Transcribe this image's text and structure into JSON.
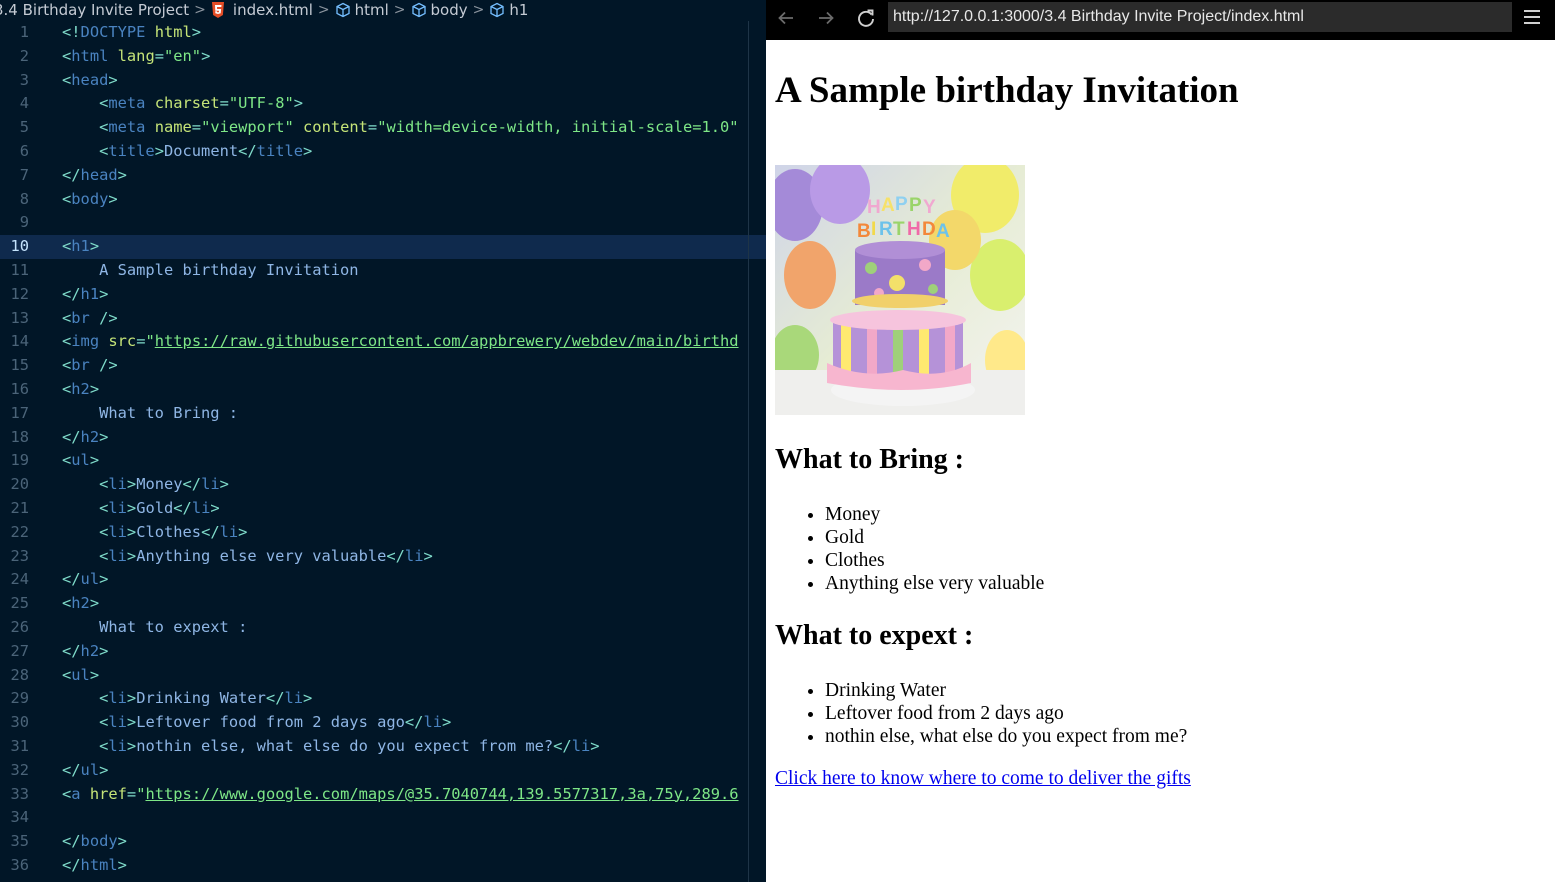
{
  "editor": {
    "breadcrumb": {
      "folder": "3.4 Birthday Invite Project",
      "file": "index.html",
      "items": [
        "html",
        "body",
        "h1"
      ]
    },
    "current_line": 10
  },
  "browser": {
    "url": "http://127.0.0.1:3000/3.4 Birthday Invite Project/index.html",
    "page": {
      "heading": "A Sample birthday Invitation",
      "image_alt": "HAPPY BIRTHDAY cake",
      "bring_heading": "What to Bring :",
      "bring_items": [
        "Money",
        "Gold",
        "Clothes",
        "Anything else very valuable"
      ],
      "expect_heading": "What to expext :",
      "expect_items": [
        "Drinking Water",
        "Leftover food from 2 days ago",
        "nothin else, what else do you expect from me?"
      ],
      "link_text": "Click here to know where to come to deliver the gifts"
    }
  },
  "icons": {
    "back": "arrow-left-icon",
    "forward": "arrow-right-icon",
    "reload": "reload-icon",
    "menu": "hamburger-menu-icon",
    "html_file": "html5-icon",
    "element": "cube-icon"
  },
  "colors": {
    "editor_bg": "#011627",
    "current_line_bg": "#0f2a4d",
    "tag": "#4a83c0",
    "attribute": "#c5e478",
    "string": "#7ee787",
    "link": "#0000ee"
  }
}
